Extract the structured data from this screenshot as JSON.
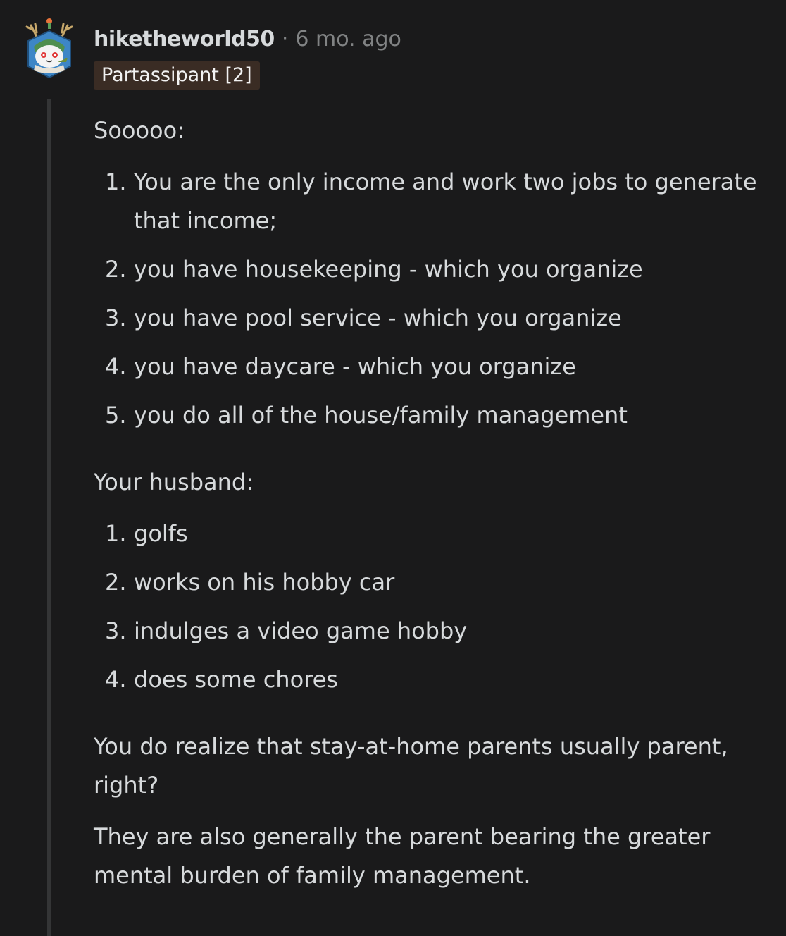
{
  "comment": {
    "author": "hiketheworld50",
    "separator": "·",
    "time": "6 mo. ago",
    "flair": "Partassipant [2]",
    "intro": "Sooooo:",
    "list1": [
      {
        "num": "1.",
        "text": "You are the only income and work two jobs to generate that income;"
      },
      {
        "num": "2.",
        "text": "you have housekeeping - which you organize"
      },
      {
        "num": "3.",
        "text": "you have pool service - which you organize"
      },
      {
        "num": "4.",
        "text": "you have daycare - which you organize"
      },
      {
        "num": "5.",
        "text": "you do all of the house/family management"
      }
    ],
    "husband_heading": "Your husband:",
    "list2": [
      {
        "num": "1.",
        "text": "golfs"
      },
      {
        "num": "2.",
        "text": "works on his hobby car"
      },
      {
        "num": "3.",
        "text": "indulges a video game hobby"
      },
      {
        "num": "4.",
        "text": "does some chores"
      }
    ],
    "question": "You do realize that stay-at-home parents usually parent, right?",
    "final": "They are also generally the parent bearing the greater mental burden of family management."
  },
  "avatar_icon": "snoo-deer-avatar-icon",
  "colors": {
    "background": "#1a1a1b",
    "text": "#d7dadc",
    "meta": "#818384",
    "flair_bg": "#3a2c24",
    "thread_line": "#343536"
  }
}
